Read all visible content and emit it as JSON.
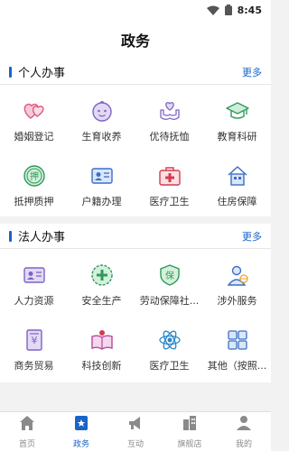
{
  "status": {
    "time": "8:45"
  },
  "header": {
    "title": "政务"
  },
  "personal": {
    "title": "个人办事",
    "more": "更多",
    "items": [
      {
        "label": "婚姻登记",
        "icon": "hearts-icon"
      },
      {
        "label": "生育收养",
        "icon": "baby-icon"
      },
      {
        "label": "优待抚恤",
        "icon": "care-hands-icon"
      },
      {
        "label": "教育科研",
        "icon": "graduation-cap-icon"
      },
      {
        "label": "抵押质押",
        "icon": "pledge-seal-icon"
      },
      {
        "label": "户籍办理",
        "icon": "id-card-icon"
      },
      {
        "label": "医疗卫生",
        "icon": "medical-kit-icon"
      },
      {
        "label": "住房保障",
        "icon": "house-icon"
      }
    ]
  },
  "corporate": {
    "title": "法人办事",
    "more": "更多",
    "items": [
      {
        "label": "人力资源",
        "icon": "id-card-icon"
      },
      {
        "label": "安全生产",
        "icon": "safety-badge-icon"
      },
      {
        "label": "劳动保障社...",
        "icon": "shield-bao-icon"
      },
      {
        "label": "涉外服务",
        "icon": "person-globe-icon"
      },
      {
        "label": "商务贸易",
        "icon": "trade-document-icon"
      },
      {
        "label": "科技创新",
        "icon": "open-book-icon"
      },
      {
        "label": "医疗卫生",
        "icon": "atom-icon"
      },
      {
        "label": "其他（按照...",
        "icon": "grid-icon"
      }
    ]
  },
  "tabs": [
    {
      "label": "首页",
      "icon": "home-icon",
      "active": false
    },
    {
      "label": "政务",
      "icon": "star-card-icon",
      "active": true
    },
    {
      "label": "互动",
      "icon": "megaphone-icon",
      "active": false
    },
    {
      "label": "旗舰店",
      "icon": "buildings-icon",
      "active": false
    },
    {
      "label": "我的",
      "icon": "person-icon",
      "active": false
    }
  ],
  "colors": {
    "accent": "#1a63c9",
    "inactive": "#8a8a8a"
  }
}
